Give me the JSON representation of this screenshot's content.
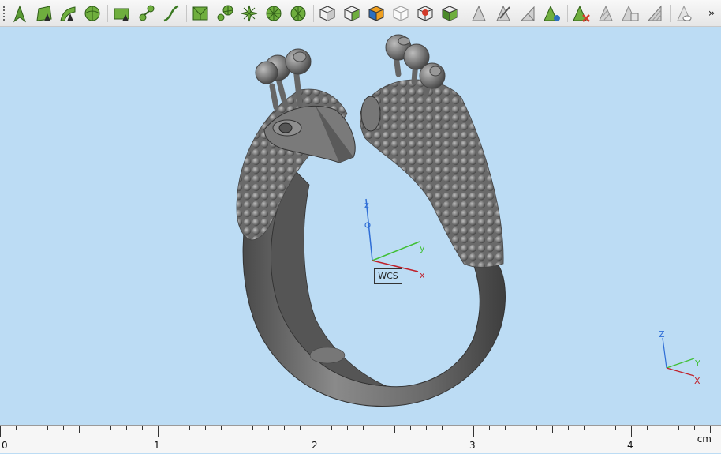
{
  "toolbar": {
    "icons": [
      "pointer-arrow-icon",
      "surface-arrow-icon",
      "curve-arrow-icon",
      "sphere-select-icon",
      "rectangle-select-icon",
      "node-select-icon",
      "curve-select-icon",
      "mesh-box-icon",
      "mesh-node-icon",
      "mesh-star-icon",
      "mesh-wheel-icon",
      "mesh-fan-icon",
      "cube-view-icon",
      "cube-view-2-icon",
      "cube-color-icon",
      "cube-outline-icon",
      "cube-red-icon",
      "cube-green-icon",
      "triangle-gray-icon",
      "triangle-edit-icon",
      "triangle-split-icon",
      "triangle-refresh-icon",
      "triangle-delete-icon",
      "triangle-hatch-icon",
      "triangle-copy-icon",
      "triangle-stripe-icon",
      "triangle-eye-icon"
    ],
    "more_label": "»"
  },
  "viewport": {
    "background": "#bcdcf4",
    "model_color": "#6e6e6e",
    "wcs": {
      "label": "WCS",
      "axis_x": "x",
      "axis_y": "y",
      "axis_z": "z"
    },
    "corner_axes": {
      "axis_x": "X",
      "axis_y": "Y",
      "axis_z": "Z"
    }
  },
  "ruler": {
    "labels": [
      "0",
      "1",
      "2",
      "3",
      "4"
    ],
    "unit": "cm"
  }
}
